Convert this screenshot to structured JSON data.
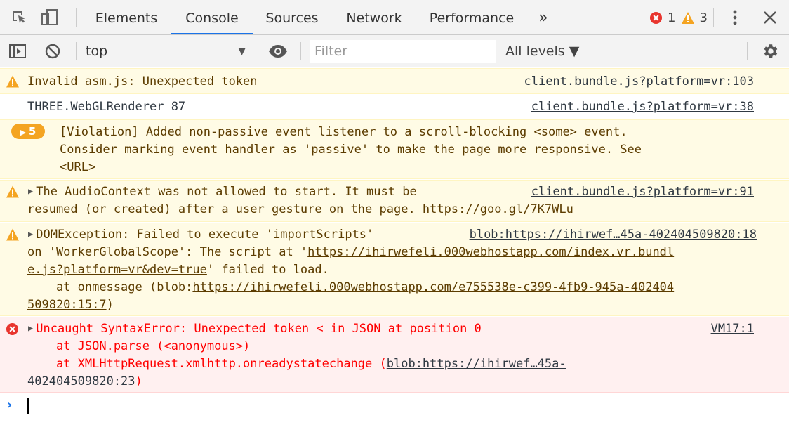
{
  "tabs": [
    "Elements",
    "Console",
    "Sources",
    "Network",
    "Performance"
  ],
  "more_tabs": "»",
  "badges": {
    "errors": "1",
    "warnings": "3"
  },
  "toolbar": {
    "context": "top",
    "filter_placeholder": "Filter",
    "levels": "All levels ▼"
  },
  "messages": {
    "m1": {
      "text": "Invalid asm.js: Unexpected token",
      "source": "client.bundle.js?platform=vr:103"
    },
    "m2": {
      "text": "THREE.WebGLRenderer 87",
      "source": "client.bundle.js?platform=vr:38"
    },
    "m3": {
      "count": "5",
      "line1": "[Violation] Added non-passive event listener to a scroll-blocking <some> event.",
      "line2": "Consider marking event handler as 'passive' to make the page more responsive. See",
      "line3": "<URL>"
    },
    "m4": {
      "line1": "The AudioContext was not allowed to start. It must be",
      "line2": "resumed (or created) after a user gesture on the page. ",
      "link": "https://goo.gl/7K7WLu",
      "source": "client.bundle.js?platform=vr:91"
    },
    "m5": {
      "line1": "DOMException: Failed to execute 'importScripts'",
      "source": "blob:https://ihirwef…45a-402404509820:18",
      "line2a": "on 'WorkerGlobalScope': The script at '",
      "line2link": "https://ihirwefeli.000webhostapp.com/index.vr.bundl",
      "line3link": "e.js?platform=vr&dev=true",
      "line3b": "' failed to load.",
      "line4a": "    at onmessage (blob:",
      "line4link": "https://ihirwefeli.000webhostapp.com/e755538e-c399-4fb9-945a-402404",
      "line5link": "509820:15:7",
      "line5b": ")"
    },
    "m6": {
      "line1": "Uncaught SyntaxError: Unexpected token < in JSON at position 0",
      "source": "VM17:1",
      "line2": "    at JSON.parse (<anonymous>)",
      "line3a": "    at XMLHttpRequest.xmlhttp.onreadystatechange (",
      "line3link": "blob:https://ihirwef…45a-",
      "line4link": "402404509820:23",
      "line4b": ")"
    }
  },
  "prompt_symbol": "›",
  "colors": {
    "accent": "#1a73e8",
    "warn_bg": "#fffbe5",
    "error_bg": "#fff0f0",
    "error_text": "#ff0000",
    "warn_badge": "#f4a422"
  }
}
